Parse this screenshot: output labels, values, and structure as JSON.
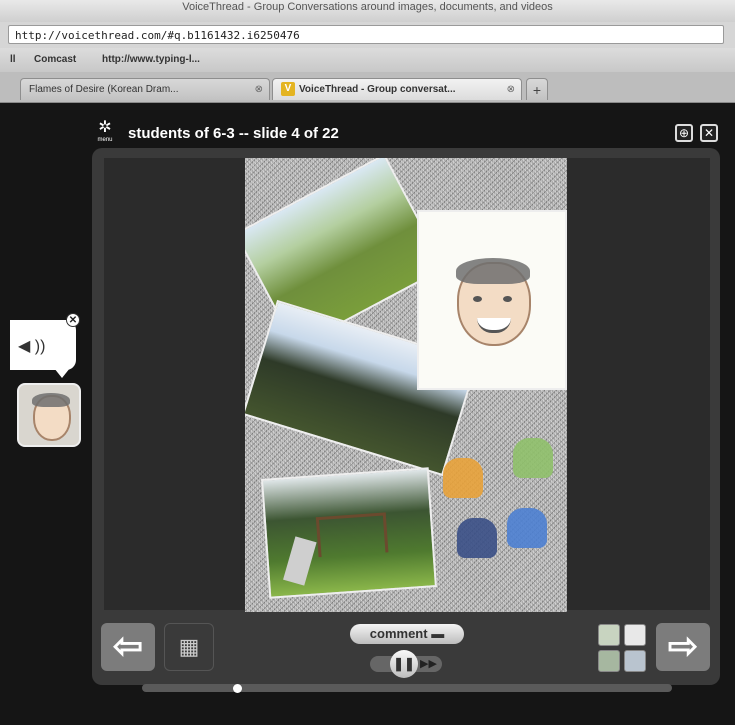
{
  "browser": {
    "window_title": "VoiceThread - Group Conversations around images, documents, and videos",
    "url": "http://voicethread.com/#q.b1161432.i6250476",
    "bookmarks": [
      "Comcast",
      "http://www.typing-l..."
    ],
    "tabs": [
      {
        "label": "Flames of Desire (Korean Dram...",
        "active": false
      },
      {
        "label": "VoiceThread - Group conversat...",
        "active": true
      }
    ],
    "new_tab_label": "+"
  },
  "voicethread": {
    "menu_label": "menu",
    "title": "students of 6-3 -- slide 4 of 22",
    "comment_label": "comment",
    "speaker_glyph": "◀ ))",
    "close_glyph": "✕",
    "prev_glyph": "⇦",
    "next_glyph": "⇨",
    "play_glyph": "❚❚",
    "ff_glyph": "▶▶",
    "progress_fraction": 0.18
  }
}
